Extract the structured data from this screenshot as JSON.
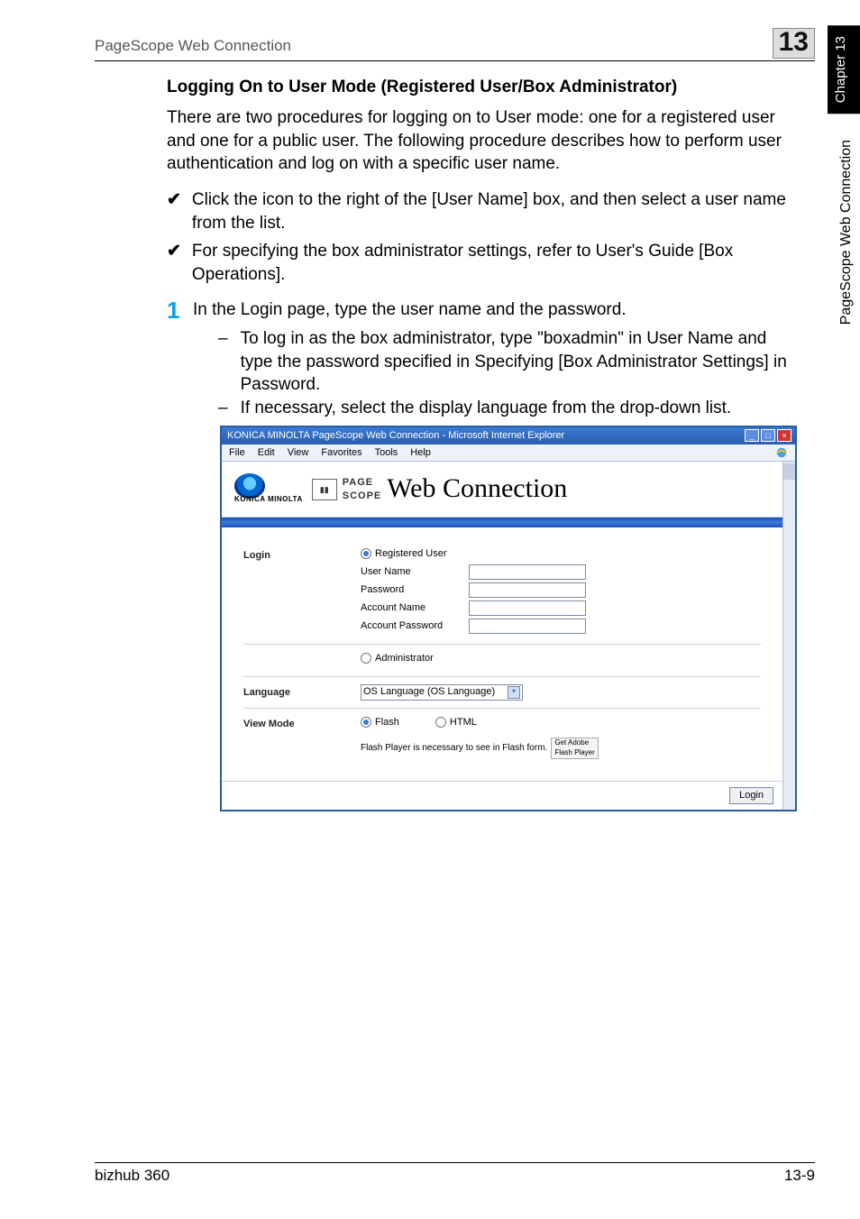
{
  "header": {
    "left": "PageScope Web Connection",
    "chapter_num": "13"
  },
  "side": {
    "tab": "Chapter 13",
    "label": "PageScope Web Connection"
  },
  "section_title": "Logging On to User Mode (Registered User/Box Administrator)",
  "intro": "There are two procedures for logging on to User mode:\none for a registered user and one for a public user. The following procedure describes how to perform user authentication and log on with a specific user name.",
  "checks": [
    "Click the icon to the right of the [User Name] box, and then select a user name from the list.",
    "For specifying the box administrator settings, refer to User's Guide [Box Operations]."
  ],
  "step1": {
    "num": "1",
    "text": "In the Login page, type the user name and the password.",
    "bullets": [
      "To log in as the box administrator, type \"boxadmin\" in User Name and type the password specified in Specifying [Box Administrator Settings] in Password.",
      "If necessary, select the display language from the drop-down list."
    ]
  },
  "browser": {
    "title": "KONICA MINOLTA PageScope Web Connection - Microsoft Internet Explorer",
    "menus": [
      "File",
      "Edit",
      "View",
      "Favorites",
      "Tools",
      "Help"
    ],
    "km_brand": "KONICA MINOLTA",
    "ps_prefix_top": "PAGE",
    "ps_prefix_bottom": "SCOPE",
    "ps_main": "Web Connection",
    "login": {
      "label": "Login",
      "registered_user": "Registered User",
      "user_name": "User Name",
      "password": "Password",
      "account_name": "Account Name",
      "account_password": "Account Password",
      "administrator": "Administrator"
    },
    "language": {
      "label": "Language",
      "value": "OS Language (OS Language)"
    },
    "view_mode": {
      "label": "View Mode",
      "flash": "Flash",
      "html": "HTML",
      "note": "Flash Player is necessary to see in Flash form.",
      "badge1": "Get Adobe",
      "badge2": "Flash Player"
    },
    "login_button": "Login"
  },
  "footer": {
    "left": "bizhub 360",
    "right": "13-9"
  }
}
